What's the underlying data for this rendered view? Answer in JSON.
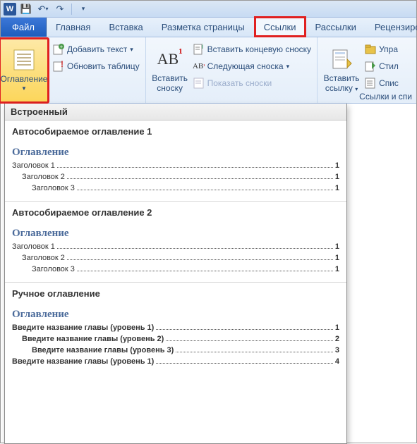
{
  "qat": {
    "app": "W",
    "save": "💾",
    "undo": "↶",
    "redo": "↷"
  },
  "tabs": {
    "file": "Файл",
    "home": "Главная",
    "insert": "Вставка",
    "layout": "Разметка страницы",
    "references": "Ссылки",
    "mailings": "Рассылки",
    "review": "Рецензиро"
  },
  "ribbon": {
    "toc_button": "Оглавление",
    "add_text": "Добавить текст",
    "update_table": "Обновить таблицу",
    "insert_footnote_top": "Вставить",
    "insert_footnote_bottom": "сноску",
    "insert_endnote": "Вставить концевую сноску",
    "next_footnote": "Следующая сноска",
    "show_notes": "Показать сноски",
    "insert_link_top": "Вставить",
    "insert_link_bottom": "ссылку",
    "manage": "Упра",
    "style": "Стил",
    "list": "Спис",
    "group_label": "Ссылки и спи"
  },
  "gallery": {
    "header": "Встроенный",
    "auto_toc_1_title": "Автособираемое оглавление 1",
    "auto_toc_2_title": "Автособираемое оглавление 2",
    "manual_toc_title": "Ручное оглавление",
    "toc_heading": "Оглавление",
    "lvl1": "Заголовок 1",
    "lvl2": "Заголовок 2",
    "lvl3": "Заголовок 3",
    "manual_l1": "Введите название главы (уровень 1)",
    "manual_l2": "Введите название главы (уровень 2)",
    "manual_l3": "Введите название главы (уровень 3)",
    "manual_l1b": "Введите название главы (уровень 1)",
    "page1": "1",
    "page2": "2",
    "page3": "3",
    "page4": "4"
  }
}
